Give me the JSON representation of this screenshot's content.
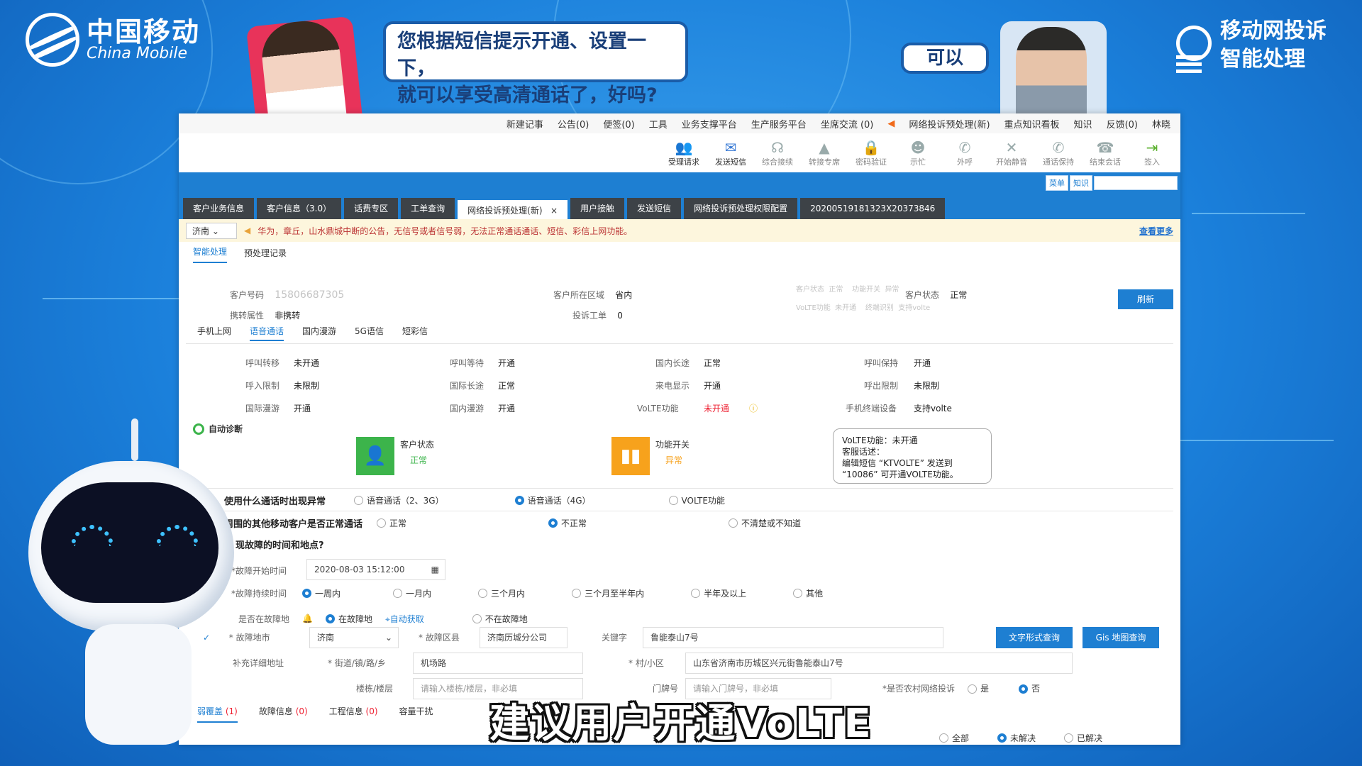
{
  "brand": {
    "cn": "中国移动",
    "en": "China Mobile",
    "right_line1": "移动网投诉",
    "right_line2": "智能处理"
  },
  "dialog": {
    "agent_line1": "您根据短信提示开通、设置一下，",
    "agent_line2": "就可以享受高清通话了，好吗?",
    "customer": "可以"
  },
  "topmenu": [
    "新建记事",
    "公告(0)",
    "便签(0)",
    "工具",
    "业务支撑平台",
    "生产服务平台",
    "坐席交流 (0)",
    "网络投诉预处理(新)",
    "重点知识看板",
    "知识",
    "反馈(0)",
    "林晓"
  ],
  "toolbar": [
    "受理请求",
    "发送短信",
    "综合接续",
    "转接专席",
    "密码验证",
    "示忙",
    "外呼",
    "开始静音",
    "通话保持",
    "结束会话",
    "签入"
  ],
  "bluebar": {
    "menu": "菜单",
    "knowledge": "知识"
  },
  "tabs": [
    "客户业务信息",
    "客户信息（3.0）",
    "话费专区",
    "工单查询",
    "网络投诉预处理(新)",
    "用户接触",
    "发送短信",
    "网络投诉预处理权限配置",
    "20200519181323X20373846"
  ],
  "notice": {
    "city": "济南",
    "text": "华为，章丘，山水鼎城中断的公告，无信号或者信号弱，无法正常通话通话、短信、彩信上网功能。",
    "more": "查看更多"
  },
  "subtabs": [
    "智能处理",
    "预处理记录"
  ],
  "customer": {
    "phone_label": "客户号码",
    "phone_value": "15806687305",
    "region_label": "客户所在区域",
    "region_value": "省内",
    "status_label": "客户状态",
    "status_value": "正常",
    "transfer_label": "携转属性",
    "transfer_value": "非携转",
    "complaint_label": "投诉工单",
    "complaint_value": "0",
    "refresh": "刷新"
  },
  "blurred": [
    "客户状态",
    "正常",
    "功能开关",
    "异常",
    "VoLTE功能",
    "未开通",
    "终端识别",
    "支持volte"
  ],
  "service_tabs": [
    "手机上网",
    "语音通话",
    "国内漫游",
    "5G语信",
    "短彩信"
  ],
  "services": [
    [
      {
        "l": "呼叫转移",
        "v": "未开通"
      },
      {
        "l": "呼叫等待",
        "v": "开通"
      },
      {
        "l": "国内长途",
        "v": "正常"
      },
      {
        "l": "呼叫保持",
        "v": "开通"
      }
    ],
    [
      {
        "l": "呼入限制",
        "v": "未限制"
      },
      {
        "l": "国际长途",
        "v": "正常"
      },
      {
        "l": "来电显示",
        "v": "开通"
      },
      {
        "l": "呼出限制",
        "v": "未限制"
      }
    ],
    [
      {
        "l": "国际漫游",
        "v": "开通"
      },
      {
        "l": "国内漫游",
        "v": "开通"
      },
      {
        "l": "VoLTE功能",
        "v": "未开通"
      },
      {
        "l": "手机终端设备",
        "v": "支持volte"
      }
    ]
  ],
  "diagnosis": {
    "title": "自动诊断",
    "card1_title": "客户状态",
    "card1_status": "正常",
    "card2_title": "功能开关",
    "card2_status": "异常"
  },
  "tooltip": {
    "line1": "VoLTE功能：未开通",
    "line2": "客服话述：",
    "line3": "编辑短信 “KTVOLTE” 发送到",
    "line4": "“10086” 可开通VOLTE功能。"
  },
  "questions": {
    "q1": "使用什么通话时出现异常",
    "q1_opts": [
      "语音通话（2、3G）",
      "语音通话（4G）",
      "VOLTE功能"
    ],
    "q2": "周围的其他移动客户是否正常通话",
    "q2_opts": [
      "正常",
      "不正常",
      "不清楚或不知道"
    ],
    "q3": "现故障的时间和地点?"
  },
  "form": {
    "start_label": "*故障开始时间",
    "start_value": "2020-08-03 15:12:00",
    "duration_label": "*故障持续时间",
    "duration_opts": [
      "一周内",
      "一月内",
      "三个月内",
      "三个月至半年内",
      "半年及以上",
      "其他"
    ],
    "at_label": "是否在故障地",
    "at_opts": [
      "在故障地",
      "自动获取",
      "不在故障地"
    ],
    "city_label": "* 故障地市",
    "city_value": "济南",
    "district_label": "* 故障区县",
    "district_value": "济南历城分公司",
    "keyword_label": "关键字",
    "keyword_value": "鲁能泰山7号",
    "btn_text": "文字形式查询",
    "btn_gis": "Gis 地图查询",
    "addr_label": "补充详细地址",
    "street_label": "* 街道/镇/路/乡",
    "street_value": "机场路",
    "village_label": "* 村/小区",
    "village_value": "山东省济南市历城区兴元街鲁能泰山7号",
    "building_label": "楼栋/楼层",
    "building_placeholder": "请输入楼栋/楼层，非必填",
    "door_label": "门牌号",
    "door_placeholder": "请输入门牌号，非必填",
    "rural_label": "*是否农村网络投诉",
    "rural_opts": [
      "是",
      "否"
    ]
  },
  "bottomtabs": [
    {
      "name": "弱覆盖",
      "count": "(1)"
    },
    {
      "name": "故障信息",
      "count": "(0)"
    },
    {
      "name": "工程信息",
      "count": "(0)"
    },
    {
      "name": "容量干扰",
      "count": ""
    }
  ],
  "filter": [
    "全部",
    "未解决",
    "已解决"
  ],
  "caption": "建议用户开通VoLTE"
}
